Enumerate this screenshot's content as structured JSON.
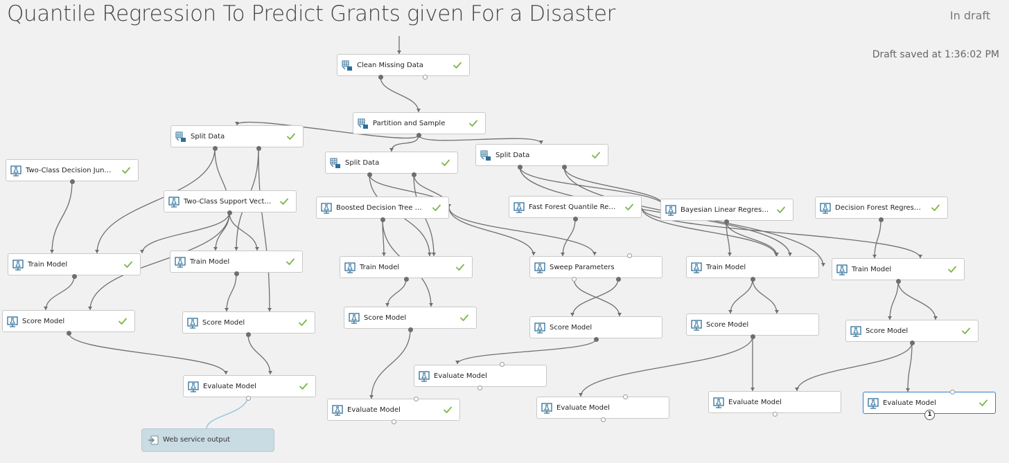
{
  "header": {
    "title": "Quantile Regression To Predict Grants given For a Disaster",
    "status": "In draft",
    "saved": "Draft saved at 1:36:02 PM"
  },
  "colors": {
    "wire": "#6f6f6f",
    "wire_webservice": "#9ec8e0",
    "check": "#7ab648",
    "selected_border": "#2f7ec8",
    "webservice_bg": "#c9dbe3"
  },
  "modules": {
    "clean_missing_data": {
      "label": "Clean Missing Data",
      "icon": "data-transform-icon",
      "completed": true
    },
    "partition_and_sample": {
      "label": "Partition and Sample",
      "icon": "data-transform-icon",
      "completed": true
    },
    "split_data_1": {
      "label": "Split Data",
      "icon": "data-transform-icon",
      "completed": true
    },
    "split_data_2": {
      "label": "Split Data",
      "icon": "data-transform-icon",
      "completed": true
    },
    "split_data_3": {
      "label": "Split Data",
      "icon": "data-transform-icon",
      "completed": true
    },
    "two_class_decision_jungle": {
      "label": "Two-Class Decision Jungle",
      "icon": "ml-model-icon",
      "completed": true
    },
    "two_class_support_vector": {
      "label": "Two-Class Support Vector...",
      "icon": "ml-model-icon",
      "completed": true
    },
    "boosted_decision_tree": {
      "label": "Boosted Decision Tree Regr...",
      "icon": "ml-model-icon",
      "completed": true
    },
    "fast_forest_quantile": {
      "label": "Fast Forest Quantile Regress...",
      "icon": "ml-model-icon",
      "completed": true
    },
    "bayesian_linear_regression": {
      "label": "Bayesian Linear Regression",
      "icon": "ml-model-icon",
      "completed": true
    },
    "decision_forest_regression": {
      "label": "Decision Forest Regression",
      "icon": "ml-model-icon",
      "completed": true
    },
    "train_model_1": {
      "label": "Train Model",
      "icon": "ml-model-icon",
      "completed": true
    },
    "train_model_2": {
      "label": "Train Model",
      "icon": "ml-model-icon",
      "completed": true
    },
    "train_model_3": {
      "label": "Train Model",
      "icon": "ml-model-icon",
      "completed": true
    },
    "sweep_parameters": {
      "label": "Sweep Parameters",
      "icon": "ml-model-icon",
      "completed": false
    },
    "train_model_4": {
      "label": "Train Model",
      "icon": "ml-model-icon",
      "completed": false
    },
    "train_model_5": {
      "label": "Train Model",
      "icon": "ml-model-icon",
      "completed": true
    },
    "score_model_1": {
      "label": "Score Model",
      "icon": "ml-model-icon",
      "completed": true
    },
    "score_model_2": {
      "label": "Score Model",
      "icon": "ml-model-icon",
      "completed": true
    },
    "score_model_3": {
      "label": "Score Model",
      "icon": "ml-model-icon",
      "completed": true
    },
    "score_model_4": {
      "label": "Score Model",
      "icon": "ml-model-icon",
      "completed": false
    },
    "score_model_5": {
      "label": "Score Model",
      "icon": "ml-model-icon",
      "completed": false
    },
    "score_model_6": {
      "label": "Score Model",
      "icon": "ml-model-icon",
      "completed": true
    },
    "evaluate_model_1": {
      "label": "Evaluate Model",
      "icon": "ml-model-icon",
      "completed": true
    },
    "evaluate_model_2": {
      "label": "Evaluate Model",
      "icon": "ml-model-icon",
      "completed": false
    },
    "evaluate_model_3": {
      "label": "Evaluate Model",
      "icon": "ml-model-icon",
      "completed": true
    },
    "evaluate_model_4": {
      "label": "Evaluate Model",
      "icon": "ml-model-icon",
      "completed": false
    },
    "evaluate_model_5": {
      "label": "Evaluate Model",
      "icon": "ml-model-icon",
      "completed": false
    },
    "evaluate_model_6": {
      "label": "Evaluate Model",
      "icon": "ml-model-icon",
      "completed": true
    }
  },
  "web_service_output": {
    "label": "Web service output",
    "icon": "web-service-output-icon"
  },
  "selection_badge": "1"
}
